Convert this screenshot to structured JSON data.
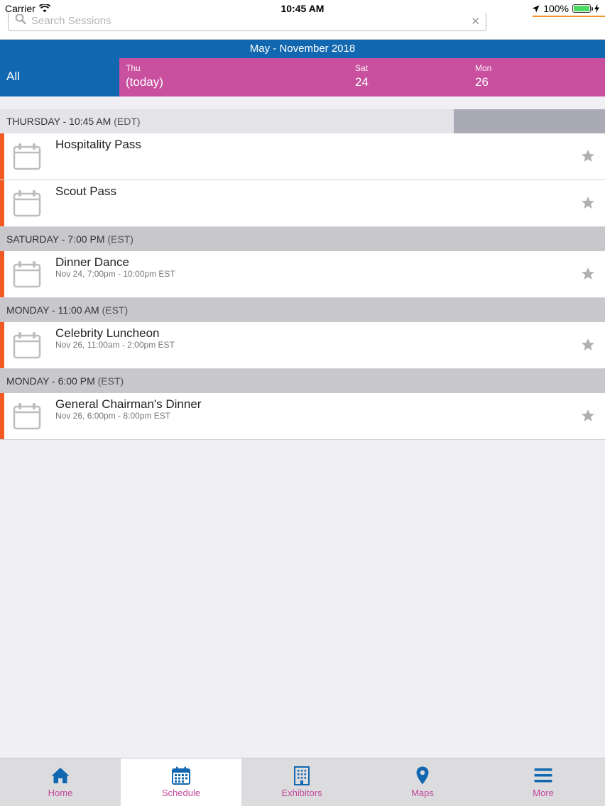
{
  "status_bar": {
    "carrier": "Carrier",
    "time": "10:45 AM",
    "battery": "100%"
  },
  "search": {
    "placeholder": "Search Sessions"
  },
  "date_header": {
    "range": "May - November 2018",
    "all_label": "All",
    "days": [
      {
        "name": "Thu",
        "num": "(today)"
      },
      {
        "name": "Sat",
        "num": "24"
      },
      {
        "name": "Mon",
        "num": "26"
      }
    ]
  },
  "sections": [
    {
      "day_time": "THURSDAY - 10:45 AM",
      "tz": "(EDT)",
      "sessions": [
        {
          "title": "Hospitality Pass",
          "time": ""
        },
        {
          "title": "Scout Pass",
          "time": ""
        }
      ]
    },
    {
      "day_time": "SATURDAY - 7:00 PM",
      "tz": "(EST)",
      "sessions": [
        {
          "title": "Dinner Dance",
          "time": "Nov 24, 7:00pm - 10:00pm EST"
        }
      ]
    },
    {
      "day_time": "MONDAY - 11:00 AM",
      "tz": "(EST)",
      "sessions": [
        {
          "title": "Celebrity Luncheon",
          "time": "Nov 26, 11:00am - 2:00pm EST"
        }
      ]
    },
    {
      "day_time": "MONDAY - 6:00 PM",
      "tz": "(EST)",
      "sessions": [
        {
          "title": "General Chairman's Dinner",
          "time": "Nov 26, 6:00pm - 8:00pm EST"
        }
      ]
    }
  ],
  "tabs": [
    {
      "label": "Home",
      "icon": "home-icon"
    },
    {
      "label": "Schedule",
      "icon": "calendar-icon"
    },
    {
      "label": "Exhibitors",
      "icon": "building-icon"
    },
    {
      "label": "Maps",
      "icon": "map-pin-icon"
    },
    {
      "label": "More",
      "icon": "menu-icon"
    }
  ],
  "colors": {
    "header_blue": "#1268b0",
    "days_magenta": "#c94f9f",
    "accent_orange": "#f25a24",
    "tab_label": "#c2479a",
    "tab_icon": "#1268b0"
  }
}
